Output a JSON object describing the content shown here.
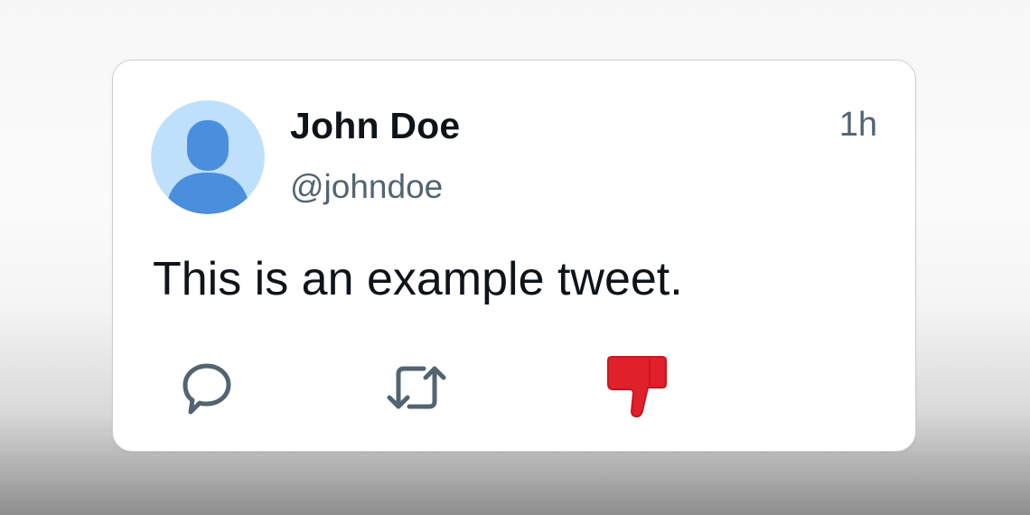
{
  "tweet": {
    "display_name": "John Doe",
    "handle": "@johndoe",
    "timestamp": "1h",
    "text": "This is an example tweet."
  },
  "actions": [
    {
      "icon": "reply-icon"
    },
    {
      "icon": "retweet-icon"
    },
    {
      "icon": "thumbs-down-icon"
    }
  ],
  "colors": {
    "avatar_background": "#bfe0fb",
    "avatar_figure": "#4a8fdd",
    "name_text": "#0f1419",
    "secondary_text": "#536471",
    "icon_gray": "#536471",
    "dislike_red": "#e0202a"
  }
}
